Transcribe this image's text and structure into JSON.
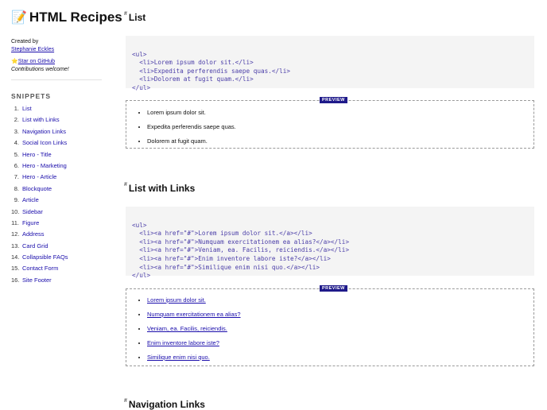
{
  "sidebar": {
    "brand_emoji": "📝",
    "brand_title": "HTML Recipes",
    "created_by_label": "Created by",
    "author": "Stephanie Eckles",
    "star_emoji": "⭐",
    "star_link": "Star on GitHub",
    "contributions": "Contributions welcome!",
    "snippets_heading": "SNIPPETS",
    "items": [
      {
        "num": "1.",
        "label": "List"
      },
      {
        "num": "2.",
        "label": "List with Links"
      },
      {
        "num": "3.",
        "label": "Navigation Links"
      },
      {
        "num": "4.",
        "label": "Social Icon Links"
      },
      {
        "num": "5.",
        "label": "Hero - Title"
      },
      {
        "num": "6.",
        "label": "Hero - Marketing"
      },
      {
        "num": "7.",
        "label": "Hero - Article"
      },
      {
        "num": "8.",
        "label": "Blockquote"
      },
      {
        "num": "9.",
        "label": "Article"
      },
      {
        "num": "10.",
        "label": "Sidebar"
      },
      {
        "num": "11.",
        "label": "Figure"
      },
      {
        "num": "12.",
        "label": "Address"
      },
      {
        "num": "13.",
        "label": "Card Grid"
      },
      {
        "num": "14.",
        "label": "Collapsible FAQs"
      },
      {
        "num": "15.",
        "label": "Contact Form"
      },
      {
        "num": "16.",
        "label": "Site Footer"
      }
    ]
  },
  "main": {
    "hash_symbol": "#",
    "preview_label": "PREVIEW",
    "sections": [
      {
        "title": "List",
        "code_lines": [
          "<ul>",
          "  <li>Lorem ipsum dolor sit.</li>",
          "  <li>Expedita perferendis saepe quas.</li>",
          "  <li>Dolorem at fugit quam.</li>",
          "</ul>"
        ],
        "preview_items": [
          "Lorem ipsum dolor sit.",
          "Expedita perferendis saepe quas.",
          "Dolorem at fugit quam."
        ]
      },
      {
        "title": "List with Links",
        "code_lines": [
          "<ul>",
          "  <li><a href=\"#\">Lorem ipsum dolor sit.</a></li>",
          "  <li><a href=\"#\">Numquam exercitationem ea alias?</a></li>",
          "  <li><a href=\"#\">Veniam, ea. Facilis, reiciendis.</a></li>",
          "  <li><a href=\"#\">Enim inventore labore iste?</a></li>",
          "  <li><a href=\"#\">Similique enim nisi quo.</a></li>",
          "</ul>"
        ],
        "preview_items": [
          "Lorem ipsum dolor sit.",
          "Numquam exercitationem ea alias?",
          "Veniam, ea. Facilis, reiciendis.",
          "Enim inventore labore iste?",
          "Similique enim nisi quo."
        ]
      },
      {
        "title": "Navigation Links"
      }
    ]
  }
}
